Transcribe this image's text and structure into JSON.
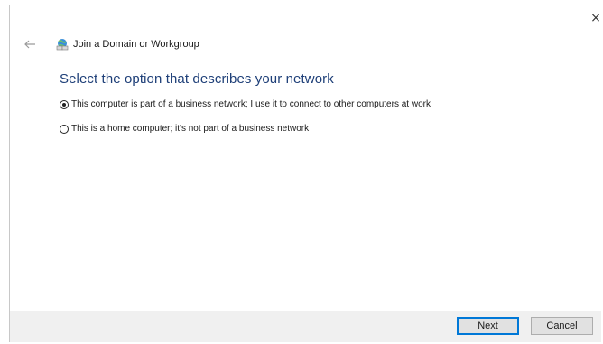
{
  "window": {
    "title": "Join a Domain or Workgroup",
    "close_glyph": "×",
    "back_icon": "back-arrow-icon",
    "title_icon": "network-globe-icon"
  },
  "main": {
    "heading": "Select the option that describes your network",
    "options": [
      {
        "label": "This computer is part of a business network; I use it to connect to other computers at work",
        "selected": true
      },
      {
        "label": "This is a home computer; it's not part of a business network",
        "selected": false
      }
    ]
  },
  "footer": {
    "next_label": "Next",
    "cancel_label": "Cancel"
  },
  "colors": {
    "heading": "#1e3f78",
    "footer_bg": "#f0f0f0",
    "default_button_border": "#0078d7"
  }
}
